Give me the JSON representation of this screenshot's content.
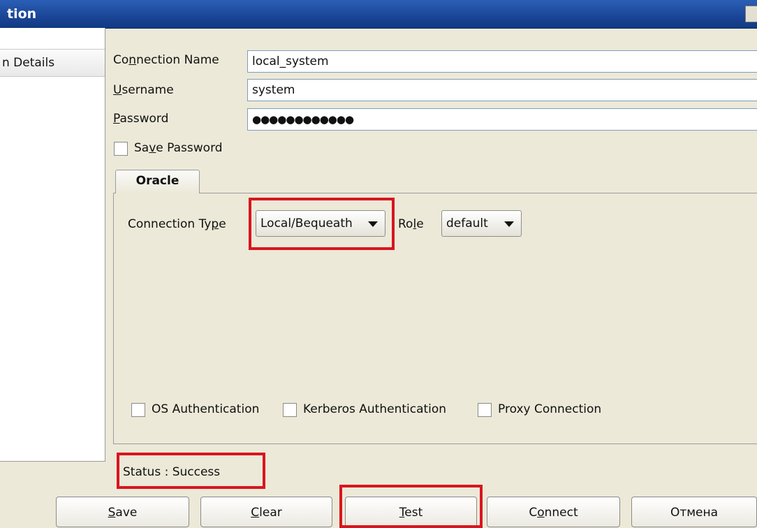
{
  "window": {
    "title": "tion"
  },
  "left_panel": {
    "item": "n Details"
  },
  "form": {
    "connection_name_pre": "Co",
    "connection_name_key": "n",
    "connection_name_post": "nection Name",
    "connection_name_value": "local_system",
    "username_key": "U",
    "username_post": "sername",
    "username_value": "system",
    "password_key": "P",
    "password_post": "assword",
    "password_value": "●●●●●●●●●●●●",
    "save_password_pre": "Sa",
    "save_password_key": "v",
    "save_password_post": "e Password"
  },
  "tab": {
    "label": "Oracle"
  },
  "oracle": {
    "connection_type_pre": "Connection Ty",
    "connection_type_key": "p",
    "connection_type_post": "e",
    "connection_type_value": "Local/Bequeath",
    "role_pre": "Ro",
    "role_key": "l",
    "role_post": "e",
    "role_value": "default",
    "os_auth": "OS Authentication",
    "kerberos_auth": "Kerberos Authentication",
    "proxy_connection": "Proxy Connection"
  },
  "status": {
    "text": "Status : Success"
  },
  "buttons": {
    "save_key": "S",
    "save_post": "ave",
    "clear_key": "C",
    "clear_post": "lear",
    "test_key": "T",
    "test_post": "est",
    "connect_pre": "C",
    "connect_key": "o",
    "connect_post": "nnect",
    "cancel": "Отмена"
  },
  "colors": {
    "highlight": "#d9151f",
    "titlebar": "#1a4596"
  }
}
